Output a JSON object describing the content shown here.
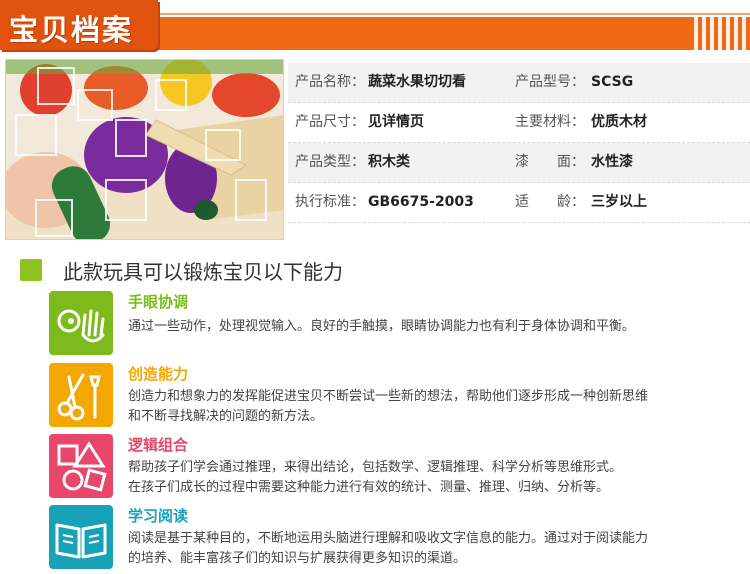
{
  "header": {
    "title": "宝贝档案",
    "accent_color": "#f06a16"
  },
  "photo": {
    "alt_name": "product-photo"
  },
  "spec": {
    "rows": [
      {
        "l1": "产品名称：",
        "v1": "蔬菜水果切切看",
        "l2": "产品型号：",
        "v2": "SCSG"
      },
      {
        "l1": "产品尺寸：",
        "v1": "见详情页",
        "l2": "主要材料：",
        "v2": "优质木材"
      },
      {
        "l1": "产品类型：",
        "v1": "积木类",
        "l2": "漆　　面：",
        "v2": "水性漆"
      },
      {
        "l1": "执行标准：",
        "v1": "GB6675-2003",
        "l2": "适　　龄：",
        "v2": "三岁以上"
      }
    ]
  },
  "abilities": {
    "heading": "此款玩具可以锻炼宝贝以下能力",
    "items": [
      {
        "title": "手眼协调",
        "color": "#7dbb1c",
        "lines": [
          "通过一些动作，处理视觉输入。良好的手触摸，眼睛协调能力也有利于身体协调和平衡。"
        ]
      },
      {
        "title": "创造能力",
        "color": "#f2a800",
        "lines": [
          "创造力和想象力的发挥能促进宝贝不断尝试一些新的想法，帮助他们逐步形成一种创新思维",
          "和不断寻找解决的问题的新方法。"
        ]
      },
      {
        "title": "逻辑组合",
        "color": "#e8476b",
        "lines": [
          "帮助孩子们学会通过推理，来得出结论，包括数学、逻辑推理、科学分析等思维形式。",
          "在孩子们成长的过程中需要这种能力进行有效的统计、测量、推理、归纳、分析等。"
        ]
      },
      {
        "title": "学习阅读",
        "color": "#17a2b8",
        "lines": [
          "阅读是基于某种目的，不断地运用头脑进行理解和吸收文字信息的能力。通过对于阅读能力",
          "的培养、能丰富孩子们的知识与扩展获得更多知识的渠道。"
        ]
      }
    ]
  }
}
